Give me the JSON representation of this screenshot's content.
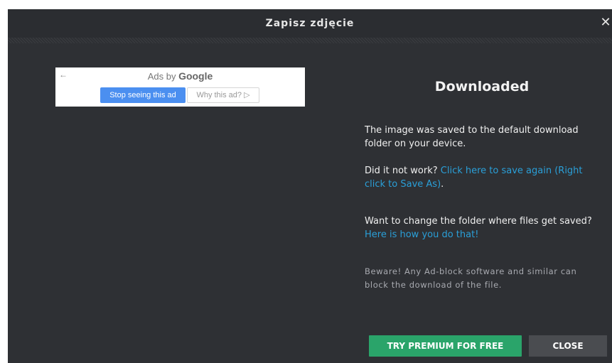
{
  "dialog": {
    "title": "Zapisz zdjęcie",
    "close_glyph": "✕"
  },
  "ad": {
    "back_glyph": "←",
    "label_prefix": "Ads by ",
    "label_brand": "Google",
    "stop_button": "Stop seeing this ad",
    "why_button": "Why this ad? ▷"
  },
  "content": {
    "heading": "Downloaded",
    "para1": "The image was saved to the default download folder on your device.",
    "para2_text": "Did it not work? ",
    "para2_link": "Click here to save again (Right click to Save As)",
    "para2_suffix": ".",
    "para3_text": "Want to change the folder where files get saved? ",
    "para3_link": "Here is how you do that!",
    "para4": "Beware! Any Ad-block software and similar can block the download of the file."
  },
  "buttons": {
    "premium": "TRY PREMIUM FOR FREE",
    "close": "CLOSE"
  },
  "colors": {
    "background": "#2e3034",
    "link": "#2a9fd8",
    "premium_button": "#2aa46a",
    "close_button": "#4a4c50"
  }
}
